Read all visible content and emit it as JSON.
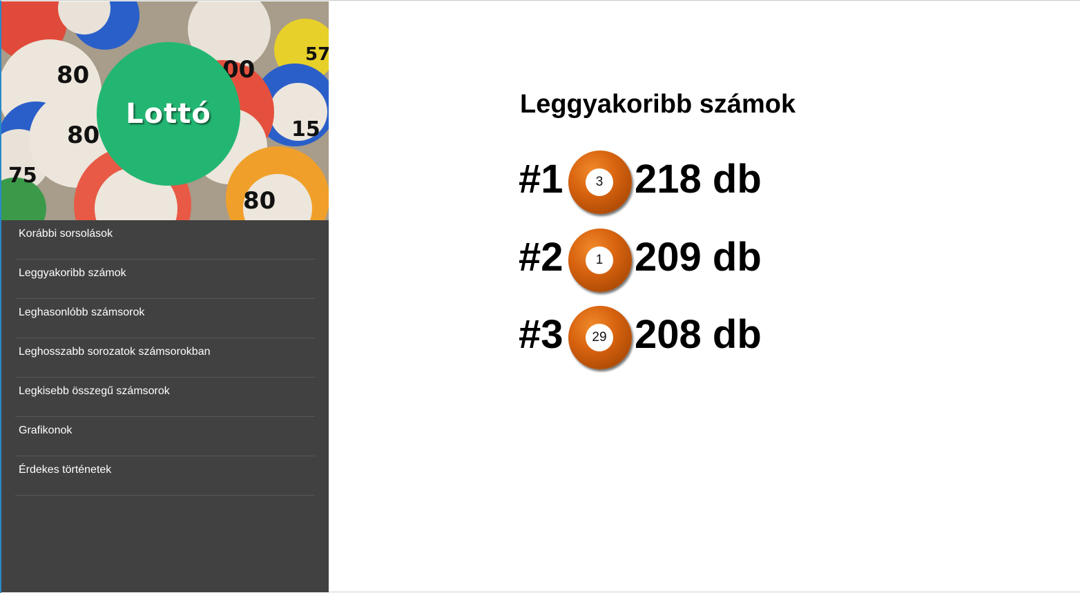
{
  "logo": {
    "text": "Lottó",
    "circle_color": "#23b672"
  },
  "sidebar": {
    "items": [
      {
        "label": "Korábbi sorsolások"
      },
      {
        "label": "Leggyakoribb számok"
      },
      {
        "label": "Leghasonlóbb számsorok"
      },
      {
        "label": "Leghosszabb sorozatok számsorokban"
      },
      {
        "label": "Legkisebb összegű számsorok"
      },
      {
        "label": "Grafikonok"
      },
      {
        "label": "Érdekes történetek"
      }
    ]
  },
  "main": {
    "title": "Leggyakoribb számok",
    "ranking": [
      {
        "rank": "#1",
        "number": "3",
        "count": "218 db"
      },
      {
        "rank": "#2",
        "number": "1",
        "count": "209 db"
      },
      {
        "rank": "#3",
        "number": "29",
        "count": "208 db"
      }
    ]
  },
  "colors": {
    "sidebar_bg": "#414141",
    "ball": "#d86310"
  }
}
